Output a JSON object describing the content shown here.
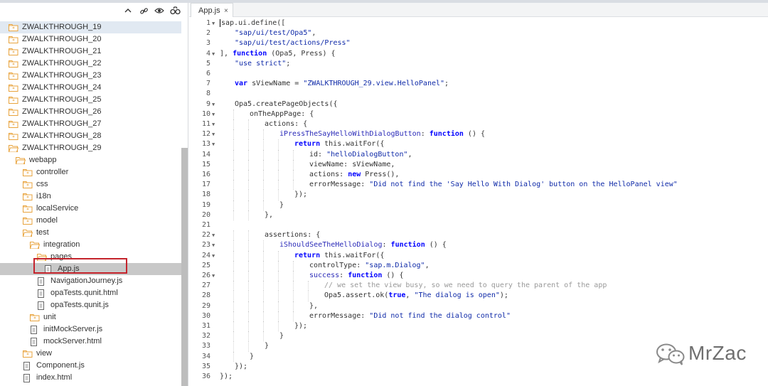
{
  "editor_tab": {
    "label": "App.js",
    "close": "×"
  },
  "tree": {
    "toolbar_icons": [
      "collapse-icon",
      "link-icon",
      "eye-icon",
      "binoculars-icon"
    ],
    "items": [
      {
        "label": "ZWALKTHROUGH_19",
        "icon": "folder-icon",
        "depth": 0
      },
      {
        "label": "ZWALKTHROUGH_20",
        "icon": "folder-icon",
        "depth": 0
      },
      {
        "label": "ZWALKTHROUGH_21",
        "icon": "folder-icon",
        "depth": 0
      },
      {
        "label": "ZWALKTHROUGH_22",
        "icon": "folder-icon",
        "depth": 0
      },
      {
        "label": "ZWALKTHROUGH_23",
        "icon": "folder-icon",
        "depth": 0
      },
      {
        "label": "ZWALKTHROUGH_24",
        "icon": "folder-icon",
        "depth": 0
      },
      {
        "label": "ZWALKTHROUGH_25",
        "icon": "folder-icon",
        "depth": 0
      },
      {
        "label": "ZWALKTHROUGH_26",
        "icon": "folder-icon",
        "depth": 0
      },
      {
        "label": "ZWALKTHROUGH_27",
        "icon": "folder-icon",
        "depth": 0
      },
      {
        "label": "ZWALKTHROUGH_28",
        "icon": "folder-icon",
        "depth": 0
      },
      {
        "label": "ZWALKTHROUGH_29",
        "icon": "folder-open-icon",
        "depth": 0
      },
      {
        "label": "webapp",
        "icon": "folder-open-icon",
        "depth": 1
      },
      {
        "label": "controller",
        "icon": "folder-icon",
        "depth": 2
      },
      {
        "label": "css",
        "icon": "folder-icon",
        "depth": 2
      },
      {
        "label": "i18n",
        "icon": "folder-icon",
        "depth": 2
      },
      {
        "label": "localService",
        "icon": "folder-icon",
        "depth": 2
      },
      {
        "label": "model",
        "icon": "folder-icon",
        "depth": 2
      },
      {
        "label": "test",
        "icon": "folder-open-icon",
        "depth": 2
      },
      {
        "label": "integration",
        "icon": "folder-open-icon",
        "depth": 3
      },
      {
        "label": "pages",
        "icon": "folder-open-icon",
        "depth": 4
      },
      {
        "label": "App.js",
        "icon": "file-icon",
        "depth": 5
      },
      {
        "label": "NavigationJourney.js",
        "icon": "file-icon",
        "depth": 4
      },
      {
        "label": "opaTests.qunit.html",
        "icon": "file-icon",
        "depth": 4
      },
      {
        "label": "opaTests.qunit.js",
        "icon": "file-icon",
        "depth": 4
      },
      {
        "label": "unit",
        "icon": "folder-icon",
        "depth": 3
      },
      {
        "label": "initMockServer.js",
        "icon": "file-icon",
        "depth": 3
      },
      {
        "label": "mockServer.html",
        "icon": "file-icon",
        "depth": 3
      },
      {
        "label": "view",
        "icon": "folder-icon",
        "depth": 2
      },
      {
        "label": "Component.js",
        "icon": "file-icon",
        "depth": 2
      },
      {
        "label": "index.html",
        "icon": "file-icon",
        "depth": 2
      }
    ],
    "highlighted_item": "ZWALKTHROUGH_19",
    "selected_item": "App.js"
  },
  "code": {
    "lines": [
      {
        "n": "1",
        "fold": true,
        "indent": 0,
        "tokens": [
          [
            "p",
            "sap.ui.define(["
          ]
        ]
      },
      {
        "n": "2",
        "fold": false,
        "indent": 1,
        "tokens": [
          [
            "s",
            "\"sap/ui/test/Opa5\""
          ],
          [
            "p",
            ","
          ]
        ]
      },
      {
        "n": "3",
        "fold": false,
        "indent": 1,
        "tokens": [
          [
            "s",
            "\"sap/ui/test/actions/Press\""
          ]
        ]
      },
      {
        "n": "4",
        "fold": true,
        "indent": 0,
        "tokens": [
          [
            "p",
            "], "
          ],
          [
            "k",
            "function"
          ],
          [
            "p",
            " (Opa5, Press) {"
          ]
        ]
      },
      {
        "n": "5",
        "fold": false,
        "indent": 1,
        "tokens": [
          [
            "s",
            "\"use strict\""
          ],
          [
            "p",
            ";"
          ]
        ]
      },
      {
        "n": "6",
        "fold": false,
        "indent": 0,
        "tokens": []
      },
      {
        "n": "7",
        "fold": false,
        "indent": 1,
        "tokens": [
          [
            "k",
            "var"
          ],
          [
            "p",
            " sViewName = "
          ],
          [
            "s",
            "\"ZWALKTHROUGH_29.view.HelloPanel\""
          ],
          [
            "p",
            ";"
          ]
        ]
      },
      {
        "n": "8",
        "fold": false,
        "indent": 0,
        "tokens": []
      },
      {
        "n": "9",
        "fold": true,
        "indent": 1,
        "tokens": [
          [
            "p",
            "Opa5.createPageObjects({"
          ]
        ]
      },
      {
        "n": "10",
        "fold": true,
        "indent": 2,
        "tokens": [
          [
            "p",
            "onTheAppPage: {"
          ]
        ]
      },
      {
        "n": "11",
        "fold": true,
        "indent": 3,
        "tokens": [
          [
            "p",
            "actions: {"
          ]
        ]
      },
      {
        "n": "12",
        "fold": true,
        "indent": 4,
        "tokens": [
          [
            "f",
            "iPressTheSayHelloWithDialogButton"
          ],
          [
            "p",
            ": "
          ],
          [
            "k",
            "function"
          ],
          [
            "p",
            " () {"
          ]
        ]
      },
      {
        "n": "13",
        "fold": true,
        "indent": 5,
        "tokens": [
          [
            "k",
            "return"
          ],
          [
            "p",
            " this.waitFor({"
          ]
        ]
      },
      {
        "n": "14",
        "fold": false,
        "indent": 6,
        "tokens": [
          [
            "p",
            "id: "
          ],
          [
            "s",
            "\"helloDialogButton\""
          ],
          [
            "p",
            ","
          ]
        ]
      },
      {
        "n": "15",
        "fold": false,
        "indent": 6,
        "tokens": [
          [
            "p",
            "viewName: sViewName,"
          ]
        ]
      },
      {
        "n": "16",
        "fold": false,
        "indent": 6,
        "tokens": [
          [
            "p",
            "actions: "
          ],
          [
            "k",
            "new"
          ],
          [
            "p",
            " Press(),"
          ]
        ]
      },
      {
        "n": "17",
        "fold": false,
        "indent": 6,
        "tokens": [
          [
            "p",
            "errorMessage: "
          ],
          [
            "s",
            "\"Did not find the 'Say Hello With Dialog' button on the HelloPanel view\""
          ]
        ]
      },
      {
        "n": "18",
        "fold": false,
        "indent": 5,
        "tokens": [
          [
            "p",
            "});"
          ]
        ]
      },
      {
        "n": "19",
        "fold": false,
        "indent": 4,
        "tokens": [
          [
            "p",
            "}"
          ]
        ]
      },
      {
        "n": "20",
        "fold": false,
        "indent": 3,
        "tokens": [
          [
            "p",
            "},"
          ]
        ]
      },
      {
        "n": "21",
        "fold": false,
        "indent": 0,
        "tokens": []
      },
      {
        "n": "22",
        "fold": true,
        "indent": 3,
        "tokens": [
          [
            "p",
            "assertions: {"
          ]
        ]
      },
      {
        "n": "23",
        "fold": true,
        "indent": 4,
        "tokens": [
          [
            "f",
            "iShouldSeeTheHelloDialog"
          ],
          [
            "p",
            ": "
          ],
          [
            "k",
            "function"
          ],
          [
            "p",
            " () {"
          ]
        ]
      },
      {
        "n": "24",
        "fold": true,
        "indent": 5,
        "tokens": [
          [
            "k",
            "return"
          ],
          [
            "p",
            " this.waitFor({"
          ]
        ]
      },
      {
        "n": "25",
        "fold": false,
        "indent": 6,
        "tokens": [
          [
            "p",
            "controlType: "
          ],
          [
            "s",
            "\"sap.m.Dialog\""
          ],
          [
            "p",
            ","
          ]
        ]
      },
      {
        "n": "26",
        "fold": true,
        "indent": 6,
        "tokens": [
          [
            "f",
            "success"
          ],
          [
            "p",
            ": "
          ],
          [
            "k",
            "function"
          ],
          [
            "p",
            " () {"
          ]
        ]
      },
      {
        "n": "27",
        "fold": false,
        "indent": 7,
        "tokens": [
          [
            "c",
            "// we set the view busy, so we need to query the parent of the app"
          ]
        ]
      },
      {
        "n": "28",
        "fold": false,
        "indent": 7,
        "tokens": [
          [
            "p",
            "Opa5.assert.ok("
          ],
          [
            "k",
            "true"
          ],
          [
            "p",
            ", "
          ],
          [
            "s",
            "\"The dialog is open\""
          ],
          [
            "p",
            ");"
          ]
        ]
      },
      {
        "n": "29",
        "fold": false,
        "indent": 6,
        "tokens": [
          [
            "p",
            "},"
          ]
        ]
      },
      {
        "n": "30",
        "fold": false,
        "indent": 6,
        "tokens": [
          [
            "p",
            "errorMessage: "
          ],
          [
            "s",
            "\"Did not find the dialog control\""
          ]
        ]
      },
      {
        "n": "31",
        "fold": false,
        "indent": 5,
        "tokens": [
          [
            "p",
            "});"
          ]
        ]
      },
      {
        "n": "32",
        "fold": false,
        "indent": 4,
        "tokens": [
          [
            "p",
            "}"
          ]
        ]
      },
      {
        "n": "33",
        "fold": false,
        "indent": 3,
        "tokens": [
          [
            "p",
            "}"
          ]
        ]
      },
      {
        "n": "34",
        "fold": false,
        "indent": 2,
        "tokens": [
          [
            "p",
            "}"
          ]
        ]
      },
      {
        "n": "35",
        "fold": false,
        "indent": 1,
        "tokens": [
          [
            "p",
            "});"
          ]
        ]
      },
      {
        "n": "36",
        "fold": false,
        "indent": 0,
        "tokens": [
          [
            "p",
            "});"
          ]
        ]
      }
    ]
  },
  "watermark": {
    "text": "MrZac",
    "icon": "wechat-icon"
  },
  "colors": {
    "keyword": "#0000ff",
    "string": "#0f2aa8",
    "comment": "#999999",
    "selection_outline": "#c4232b",
    "folder": "#e8a33c"
  }
}
